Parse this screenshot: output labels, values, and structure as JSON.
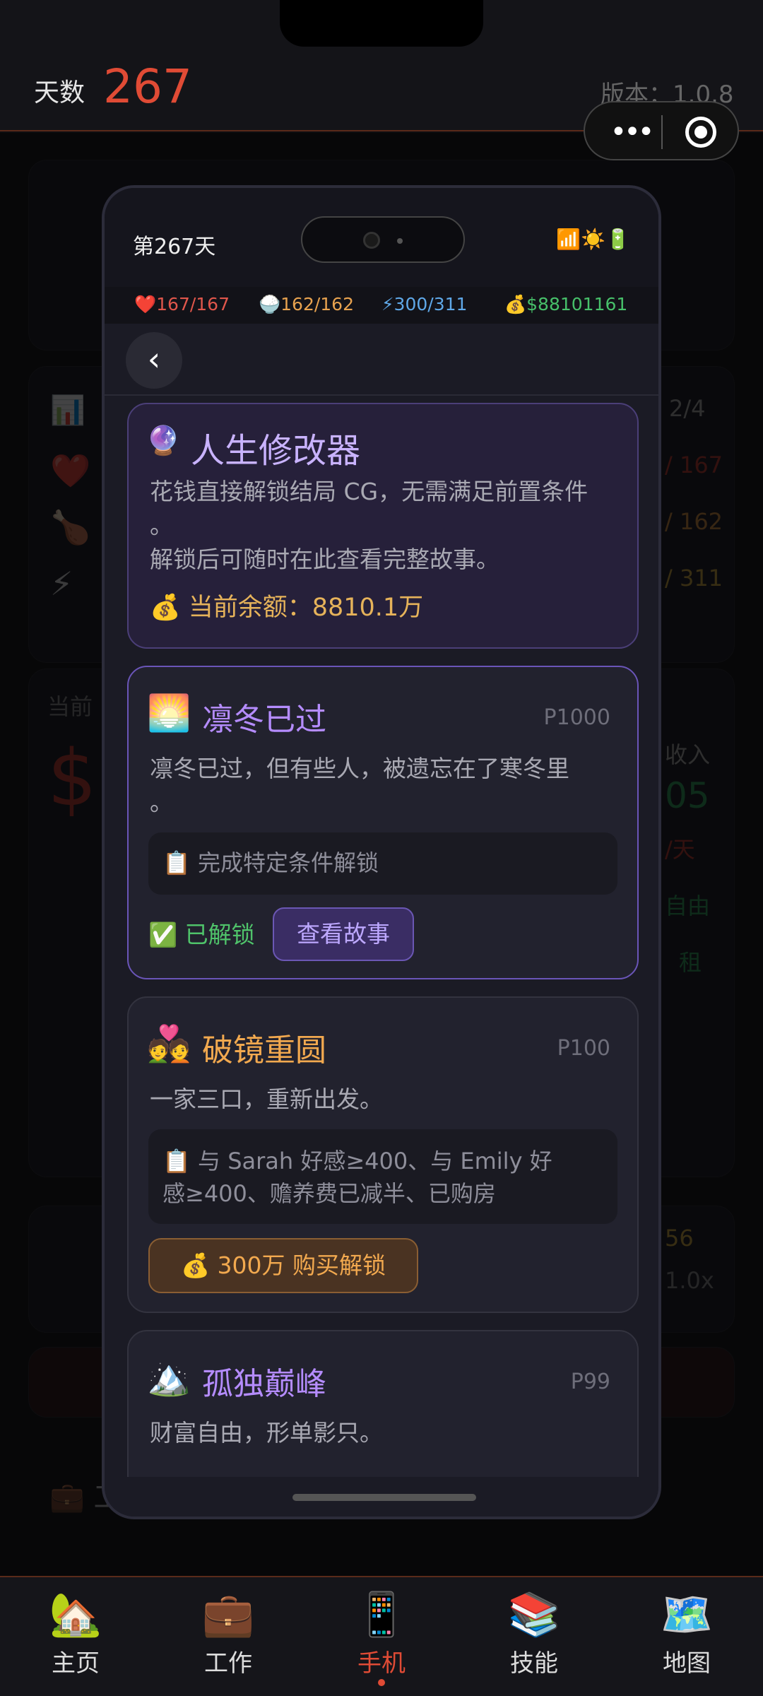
{
  "header": {
    "days_label": "天数",
    "days_value": "267",
    "version": "版本：1.0.8"
  },
  "phone": {
    "status_day": "第267天",
    "status_icons": "📶☀️🔋",
    "stats": {
      "hp": "❤️167/167",
      "food": "🍚162/162",
      "energy": "⚡300/311",
      "money": "💰$88101161"
    },
    "back_label": "‹",
    "modifier": {
      "icon": "🔮",
      "title": "人生修改器",
      "desc1": "花钱直接解锁结局 CG，无需满足前置条件",
      "desc1_wrap": "。",
      "desc2": "解锁后可随时在此查看完整故事。",
      "balance": "💰 当前余额：8810.1万"
    },
    "endings": [
      {
        "icon": "🌅",
        "title": "凛冬已过",
        "code": "P1000",
        "desc": "凛冬已过，但有些人，被遗忘在了寒冬里",
        "desc_wrap": "。",
        "condition": "📋 完成特定条件解锁",
        "status": "✅ 已解锁",
        "action": "查看故事"
      },
      {
        "icon": "💑",
        "title": "破镜重圆",
        "code": "P100",
        "desc": "一家三口，重新出发。",
        "condition_line1": "📋 与 Sarah 好感≥400、与 Emily 好",
        "condition_line2": "感≥400、赡养费已减半、已购房",
        "action": "💰 300万 购买解锁"
      },
      {
        "icon": "🏔️",
        "title": "孤独巅峰",
        "code": "P99",
        "desc": "财富自由，形单影只。"
      }
    ]
  },
  "background": {
    "page_label": "2/4",
    "hp": "/ 167",
    "food": "/ 162",
    "energy": "/ 311",
    "current": "当前",
    "income": "收入",
    "income_val": "05",
    "per_day": "/天",
    "free": "自由",
    "rent": "租",
    "score": "56",
    "mult": "1.0x",
    "work_header": "💼 工作"
  },
  "bottom_nav": [
    {
      "icon": "🏡",
      "label": "主页"
    },
    {
      "icon": "💼",
      "label": "工作"
    },
    {
      "icon": "📱",
      "label": "手机"
    },
    {
      "icon": "📚",
      "label": "技能"
    },
    {
      "icon": "🗺️",
      "label": "地图"
    }
  ],
  "colors": {
    "accent": "#e04b35",
    "purple": "#b58cff",
    "orange": "#f2a94f",
    "green": "#4fc36a"
  }
}
